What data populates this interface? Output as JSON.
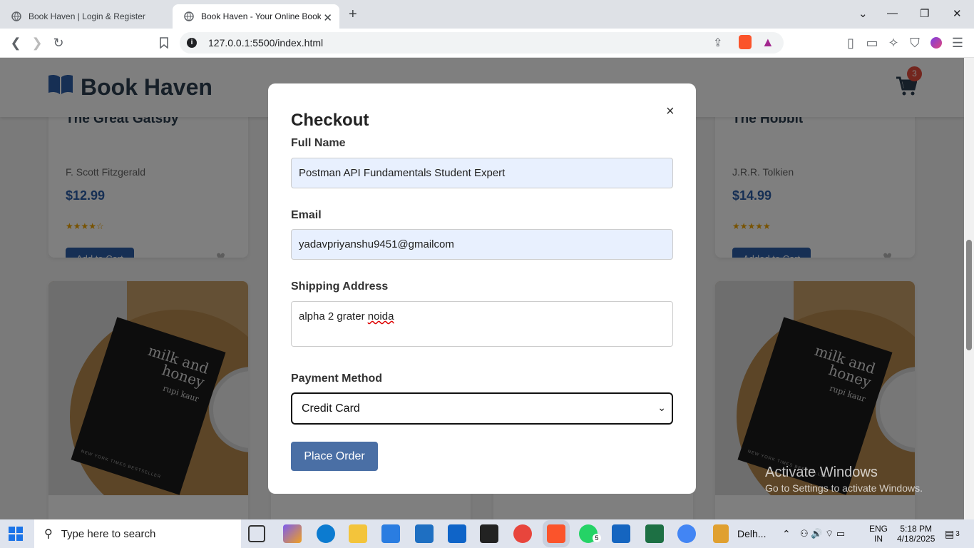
{
  "browser": {
    "tabs": [
      {
        "label": "Book Haven | Login & Register",
        "active": false
      },
      {
        "label": "Book Haven - Your Online Book",
        "active": true
      }
    ],
    "new_tab": "+",
    "url": "127.0.0.1:5500/index.html"
  },
  "site": {
    "brand": "Book Haven",
    "cart_count": "3"
  },
  "cards": [
    {
      "title": "The Great Gatsby",
      "author": "F. Scott Fitzgerald",
      "price": "$12.99",
      "stars": "★★★★☆",
      "button": "Add to Cart"
    },
    {
      "title": "The Hobbit",
      "author": "J.R.R. Tolkien",
      "price": "$14.99",
      "stars": "★★★★★",
      "button": "Added to Cart"
    }
  ],
  "cover": {
    "title": "milk and honey",
    "author": "rupi kaur",
    "footer": "NEW YORK TIMES BESTSELLER"
  },
  "modal": {
    "title": "Checkout",
    "close": "×",
    "full_name_label": "Full Name",
    "full_name_value": "Postman API Fundamentals Student Expert",
    "email_label": "Email",
    "email_value": "yadavpriyanshu9451@gmailcom",
    "address_label": "Shipping Address",
    "address_value_a": "alpha 2 grater ",
    "address_value_b": "noida",
    "payment_label": "Payment Method",
    "payment_value": "Credit Card",
    "submit": "Place Order"
  },
  "watermark": {
    "line1": "Activate Windows",
    "line2": "Go to Settings to activate Windows."
  },
  "taskbar": {
    "search_placeholder": "Type here to search",
    "weather": "Delh...",
    "lang1": "ENG",
    "lang2": "IN",
    "time": "5:18 PM",
    "date": "4/18/2025",
    "notifications": "3",
    "whatsapp_badge": "5"
  },
  "colors": {
    "accent": "#2c5ea8",
    "place_order": "#4a6fa5",
    "badge": "#e74c3c"
  }
}
